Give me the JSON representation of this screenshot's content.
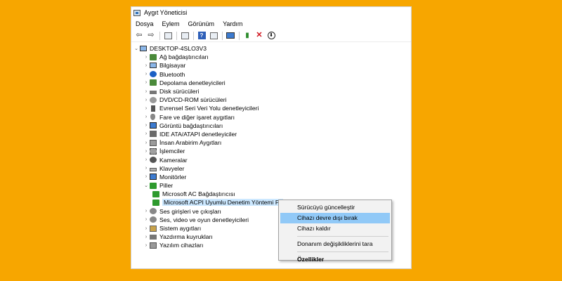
{
  "window": {
    "title": "Aygıt Yöneticisi"
  },
  "menu": [
    "Dosya",
    "Eylem",
    "Görünüm",
    "Yardım"
  ],
  "tree": {
    "root": "DESKTOP-4SLO3V3",
    "items": [
      {
        "label": "Ağ bağdaştırıcıları",
        "icon": "network-icon"
      },
      {
        "label": "Bilgisayar",
        "icon": "computer-icon"
      },
      {
        "label": "Bluetooth",
        "icon": "bluetooth-icon"
      },
      {
        "label": "Depolama denetleyicileri",
        "icon": "storage-icon"
      },
      {
        "label": "Disk sürücüleri",
        "icon": "disk-icon"
      },
      {
        "label": "DVD/CD-ROM sürücüleri",
        "icon": "dvd-icon"
      },
      {
        "label": "Evrensel Seri Veri Yolu denetleyicileri",
        "icon": "usb-icon"
      },
      {
        "label": "Fare ve diğer işaret aygıtları",
        "icon": "mouse-icon"
      },
      {
        "label": "Görüntü bağdaştırıcıları",
        "icon": "display-adapter-icon"
      },
      {
        "label": "IDE ATA/ATAPI denetleyiciler",
        "icon": "ide-icon"
      },
      {
        "label": "İnsan Arabirim Aygıtları",
        "icon": "hid-icon"
      },
      {
        "label": "İşlemciler",
        "icon": "processor-icon"
      },
      {
        "label": "Kameralar",
        "icon": "camera-icon"
      },
      {
        "label": "Klavyeler",
        "icon": "keyboard-icon"
      },
      {
        "label": "Monitörler",
        "icon": "monitor-icon"
      },
      {
        "label": "Piller",
        "icon": "battery-icon"
      }
    ],
    "battery_children": [
      "Microsoft AC Bağdaştırıcısı",
      "Microsoft ACPI Uyumlu Denetim Yöntemi Pil"
    ],
    "items_after": [
      {
        "label": "Ses girişleri ve çıkışları",
        "icon": "audio-io-icon"
      },
      {
        "label": "Ses, video ve oyun denetleyicileri",
        "icon": "sound-icon"
      },
      {
        "label": "Sistem aygıtları",
        "icon": "system-devices-icon"
      },
      {
        "label": "Yazdırma kuyrukları",
        "icon": "print-queue-icon"
      },
      {
        "label": "Yazılım cihazları",
        "icon": "software-device-icon"
      }
    ]
  },
  "context_menu": {
    "update_driver": "Sürücüyü güncelleştir",
    "disable_device": "Cihazı devre dışı bırak",
    "uninstall_device": "Cihazı kaldır",
    "scan_hardware": "Donanım değişikliklerini tara",
    "properties": "Özellikler"
  },
  "colors": {
    "background": "#F7A600",
    "selection": "#cce8ff",
    "menu_highlight": "#91c9f7"
  }
}
